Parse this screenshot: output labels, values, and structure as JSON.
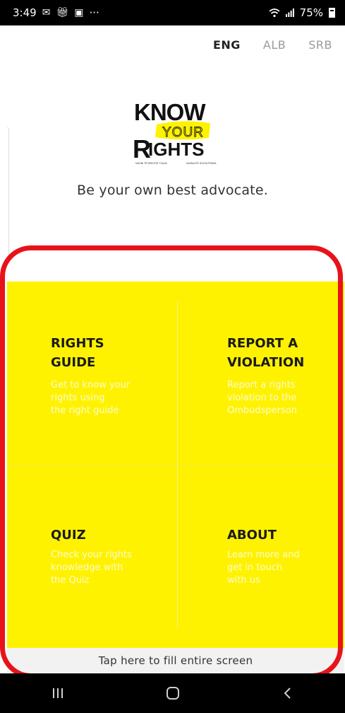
{
  "status_bar": {
    "time": "3:49",
    "left_icons": [
      "notification-icon",
      "gift-icon",
      "image-icon"
    ],
    "more": "···",
    "battery_percent": "75%"
  },
  "languages": [
    {
      "label": "ENG",
      "active": true
    },
    {
      "label": "ALB",
      "active": false
    },
    {
      "label": "SRB",
      "active": false
    }
  ],
  "logo": {
    "line1": "KNOW",
    "line2": "YOUR",
    "line3": "RIGHTS",
    "fine_print_left": "NJIHNI TË DREJTAT TUAJA",
    "fine_print_right": "SAZNAJTE SVOJA PRAVA"
  },
  "tagline": "Be your own best advocate.",
  "cards": [
    {
      "title": "RIGHTS\nGUIDE",
      "desc": "Get to know your\nrights using\nthe right guide"
    },
    {
      "title": "REPORT A\nVIOLATION",
      "desc": "Report a rights\nviolation to the\nOmbudsperson"
    },
    {
      "title": "QUIZ",
      "desc": "Check your rights\nknowledge with\nthe Quiz"
    },
    {
      "title": "ABOUT",
      "desc": "Learn more and\nget in touch\nwith us"
    }
  ],
  "fill_screen_label": "Tap here to fill entire screen",
  "colors": {
    "accent_yellow": "#fff200",
    "highlight_red": "#e8131a",
    "status_bar": "#000000"
  },
  "nav": [
    "recent-apps-icon",
    "home-icon",
    "back-icon"
  ]
}
